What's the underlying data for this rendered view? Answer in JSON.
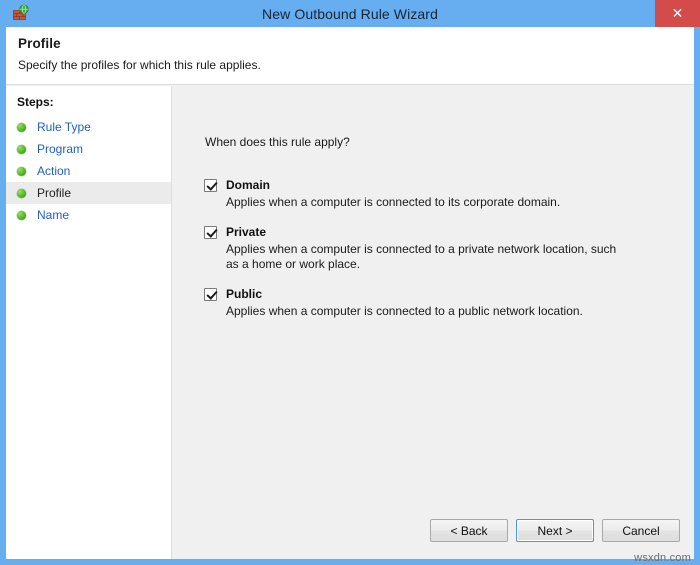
{
  "window": {
    "title": "New Outbound Rule Wizard",
    "icon": "firewall-shield-icon",
    "close_label": "✕",
    "frame_color": "#67aef0",
    "close_color": "#d44b4b"
  },
  "header": {
    "title": "Profile",
    "subtitle": "Specify the profiles for which this rule applies."
  },
  "sidebar": {
    "steps_label": "Steps:",
    "items": [
      {
        "label": "Rule Type",
        "current": false
      },
      {
        "label": "Program",
        "current": false
      },
      {
        "label": "Action",
        "current": false
      },
      {
        "label": "Profile",
        "current": true
      },
      {
        "label": "Name",
        "current": false
      }
    ],
    "link_color": "#1f5fbf",
    "bullet_color": "#52b820"
  },
  "main": {
    "question": "When does this rule apply?",
    "options": [
      {
        "label": "Domain",
        "checked": true,
        "description": "Applies when a computer is connected to its corporate domain."
      },
      {
        "label": "Private",
        "checked": true,
        "description": "Applies when a computer is connected to a private network location, such as a home or work place."
      },
      {
        "label": "Public",
        "checked": true,
        "description": "Applies when a computer is connected to a public network location."
      }
    ]
  },
  "buttons": {
    "back": "< Back",
    "next": "Next >",
    "cancel": "Cancel",
    "default_focus_color": "#4e97d4"
  },
  "watermark": "wsxdn.com"
}
